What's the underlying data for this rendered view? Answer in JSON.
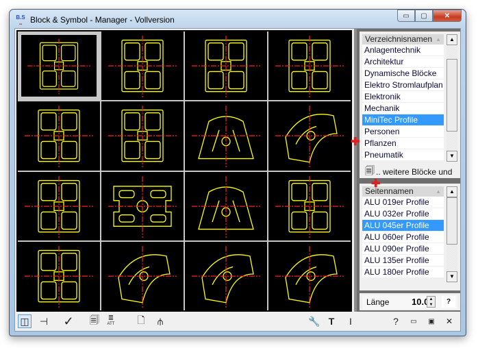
{
  "window": {
    "title": "Block & Symbol - Manager - Vollversion",
    "logo": "B.S",
    "buttons": [
      "minimize",
      "maximize",
      "close"
    ]
  },
  "grid": {
    "selected_index": 0,
    "cell_count": 16,
    "colors": {
      "outline": "#ffff00",
      "centerline": "#ff2020",
      "background": "#000000"
    }
  },
  "directory_list": {
    "header": "Verzeichnisnamen",
    "items": [
      "Anlagentechnik",
      "Architektur",
      "Dynamische Blöcke",
      "Elektro Stromlaufplan",
      "Elektronik",
      "Mechanik",
      "MiniTec Profile",
      "Personen",
      "Pflanzen",
      "Pneumatik"
    ],
    "selected": "MiniTec Profile",
    "more_label": ".. weitere Blöcke und"
  },
  "page_list": {
    "header": "Seitennamen",
    "items": [
      "ALU 019er Profile",
      "ALU 032er Profile",
      "ALU 045er Profile",
      "ALU 060er Profile",
      "ALU 090er Profile",
      "ALU 135er Profile",
      "ALU 180er Profile"
    ],
    "selected": "ALU 045er Profile"
  },
  "length": {
    "label": "Länge",
    "value": "10.0",
    "help": "?"
  },
  "toolbar": {
    "left_icons": [
      "panel-toggle-icon",
      "pin-icon",
      "check-icon",
      "block-list-icon",
      "attribute-icon",
      "new-document-icon",
      "brush-icon"
    ],
    "right_icons": [
      "wrench-icon",
      "text-icon",
      "cursor-icon",
      "help-icon",
      "minimize-icon",
      "restore-icon",
      "close-icon"
    ],
    "attribute_label": "ATT",
    "help_label": "?"
  }
}
